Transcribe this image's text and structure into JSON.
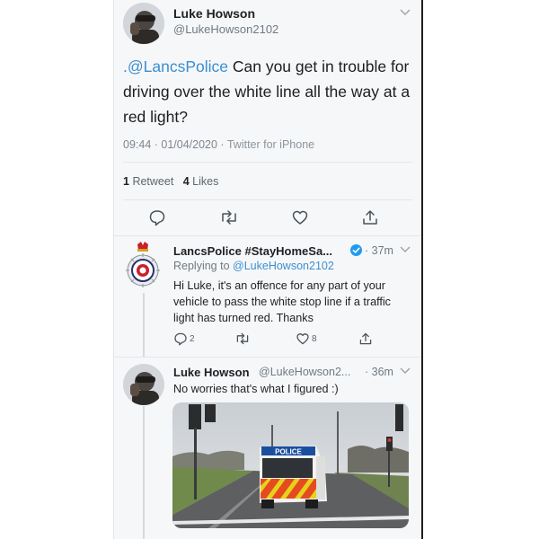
{
  "tweet": {
    "author_name": "Luke Howson",
    "author_handle": "@LukeHowson2102",
    "mention": ".@LancsPolice",
    "text": " Can you get in trouble for driving over the white line all the way at a red light?",
    "timestamp": "09:44 · 01/04/2020 ·",
    "source": "Twitter for iPhone",
    "retweet_count": "1",
    "retweet_label": "Retweet",
    "like_count": "4",
    "like_label": "Likes"
  },
  "reply1": {
    "author_name": "LancsPolice #StayHomeSa...",
    "time": "· 37m",
    "replying_prefix": "Replying to",
    "replying_handle": "@LukeHowson2102",
    "text": "Hi Luke, it's an offence for any part of your vehicle to pass the white stop line if a traffic light has turned red. Thanks",
    "reply_count": "2",
    "like_count": "8",
    "verified": true
  },
  "reply2": {
    "author_name": "Luke Howson",
    "author_handle": "@LukeHowson2...",
    "time": "· 36m",
    "text": "No worries that's what I figured :)"
  },
  "photo": {
    "van_label": "POLICE"
  },
  "icons": [
    "reply-icon",
    "retweet-icon",
    "like-icon",
    "share-icon",
    "verified-icon",
    "chevron-down-icon",
    "police-badge-icon"
  ],
  "colors": {
    "link": "#3b8fd1",
    "panel_bg": "#f6f7f8",
    "verified": "#1d9bf0"
  }
}
